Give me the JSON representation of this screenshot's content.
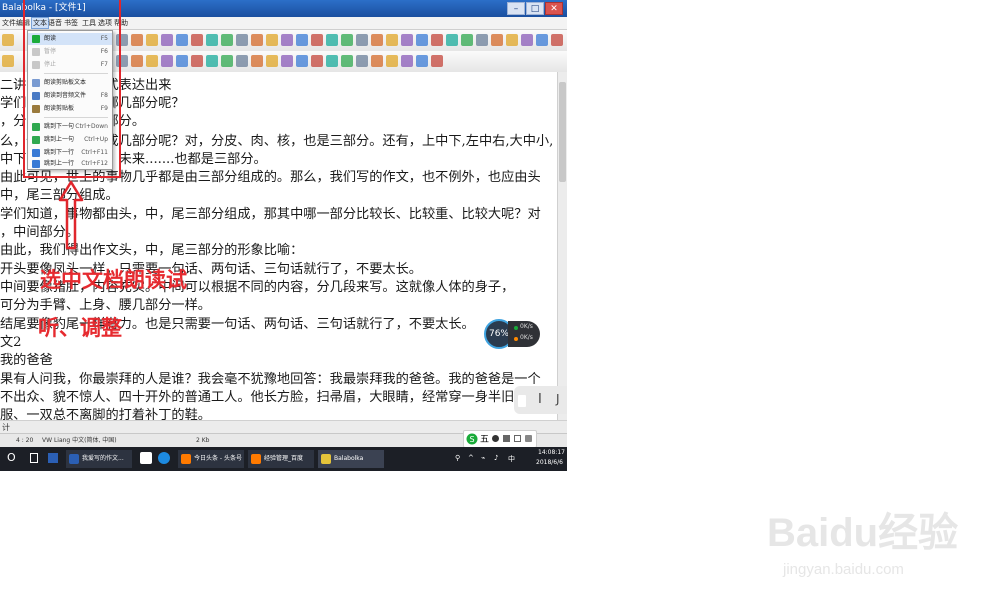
{
  "window": {
    "title": "Balabolka - [文件1]",
    "buttons": {
      "minimize": "–",
      "maximize": "□",
      "close": "✕"
    }
  },
  "menubar": {
    "items": [
      "文件",
      "编辑",
      "文本",
      "语音",
      "书签",
      "工具",
      "选项",
      "帮助"
    ]
  },
  "speech_menu": {
    "items": [
      {
        "label": "朗读",
        "shortcut": "F5"
      },
      {
        "label": "暂停",
        "shortcut": "F6"
      },
      {
        "label": "停止",
        "shortcut": "F7"
      },
      {
        "label": "朗读剪贴板文本",
        "shortcut": ""
      },
      {
        "label": "朗读到音频文件",
        "shortcut": "F8"
      },
      {
        "label": "朗读剪贴板",
        "shortcut": "F9"
      },
      {
        "label": "跳到下一句",
        "shortcut": "Ctrl+Down"
      },
      {
        "label": "跳到上一句",
        "shortcut": "Ctrl+Up"
      },
      {
        "label": "跳到下一行",
        "shortcut": "Ctrl+F11"
      },
      {
        "label": "跳到上一行",
        "shortcut": "Ctrl+F12"
      }
    ]
  },
  "document": {
    "lines": [
      "二讲：用完美的形式表达出来",
      "学们，从头到尾有哪几部分呢？",
      "，分头、中、尾三部分。",
      "么，你们知道它分成几部分呢？对，分皮、肉、核，也是三部分。还有，上中下,左中右,大中小,",
      "中下，过去、现在、未来.......也都是三部分。",
      "由此可见，世上的事物几乎都是由三部分组成的。那么，我们写的作文，也不例外，也应由头",
      "中，尾三部分组成。",
      "学们知道，事物都由头，中，尾三部分组成，那其中哪一部分比较长、比较重、比较大呢？对",
      "，中间部分。",
      "  由此，我们得出作文头，中，尾三部分的形象比喻：",
      "  开头要像凤头一样，只需要一句话、两句话、三句话就行了，不要太长。",
      "  中间要像猪肚，内容充实。中间可以根据不同的内容，分几段来写。这就像人体的身子，",
      "可分为手臂、上身、腰几部分一样。",
      "  结尾要像豹尾一样有力。也是只需要一句话、两句话、三句话就行了，不要太长。",
      "文2",
      "我的爸爸",
      "果有人问我，你最崇拜的人是谁？我会毫不犹豫地回答：我最崇拜我的爸爸。我的爸爸是一个",
      "不出众、貌不惊人、四十开外的普通工人。他长方脸，扫帚眉，大眼睛，经常穿一身半旧的中",
      "服、一双总不离脚的打着补丁的鞋。"
    ]
  },
  "annotation": {
    "line1": "选中文档朗读试",
    "line2": "听、调整"
  },
  "widget": {
    "percent": "76%",
    "stat1": "0K/s",
    "stat2": "0K/s"
  },
  "edge_panel": {
    "icon1": "▯",
    "icon2": "I",
    "icon3": "J"
  },
  "hscroll": {
    "label": "计"
  },
  "statusbar": {
    "position": "4 : 20",
    "voice": "VW Liang 中文(简体, 中国)",
    "size": "2 Kb"
  },
  "ime": {
    "label": "五"
  },
  "taskbar": {
    "start": "O",
    "items": [
      {
        "label": "我爱写的作文...",
        "color": "#2b5fb4"
      },
      {
        "label": "今日头条 - 头条号",
        "color": "#ff7a00"
      },
      {
        "label": "经验管理_百度",
        "color": "#ff7a00"
      },
      {
        "label": "Balabolka",
        "color": "#e4c33a"
      }
    ],
    "clock": "14:08:17",
    "date": "2018/6/6"
  },
  "watermark": {
    "brand": "Baidu经验",
    "url": "jingyan.baidu.com"
  },
  "colors": {
    "annotation": "#e62a2f",
    "titlebar": "#1b4f9f",
    "taskbar": "#1c1f26"
  }
}
